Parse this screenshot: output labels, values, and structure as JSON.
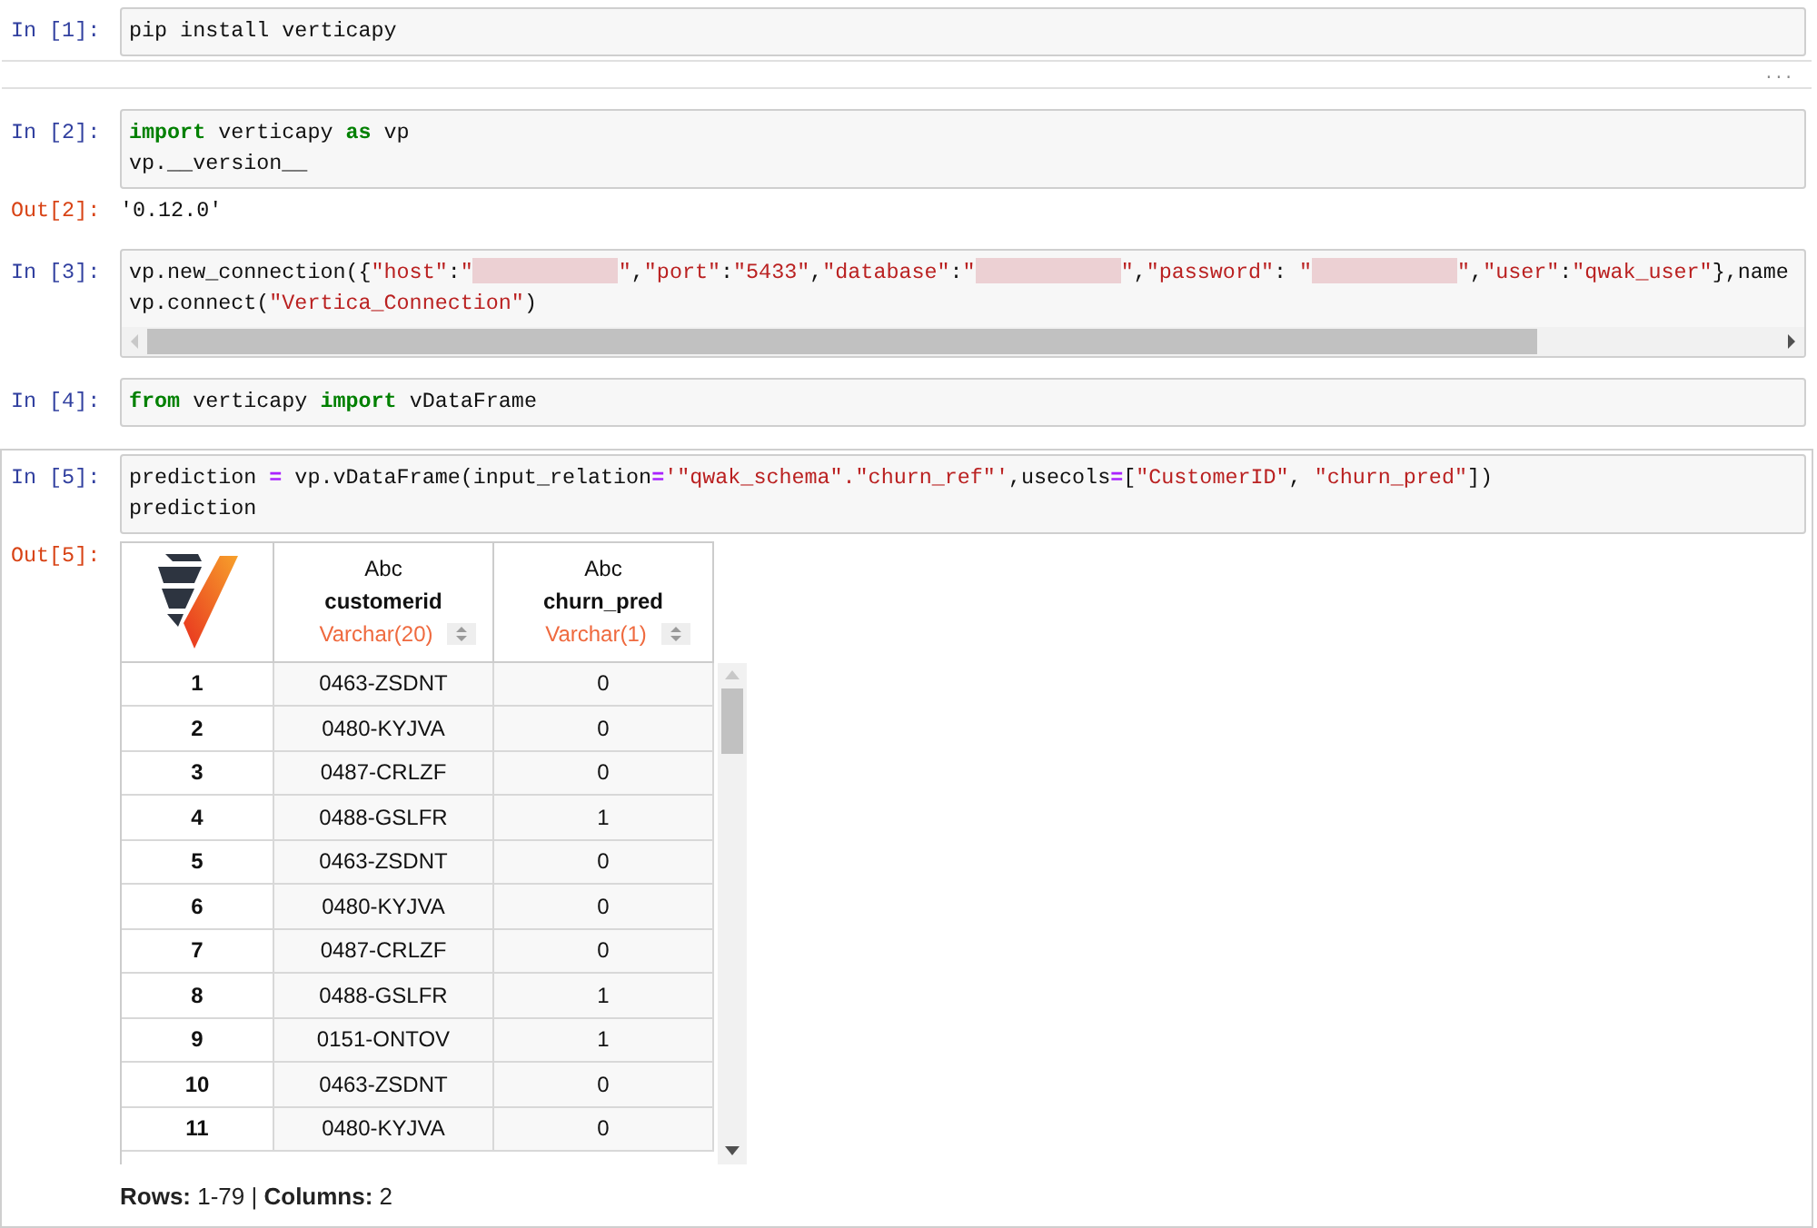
{
  "cells": [
    {
      "prompt": "In [1]:",
      "selected": false,
      "scrollbar": false,
      "lines": [
        [
          {
            "kind": "plain",
            "text": "pip install verticapy"
          }
        ]
      ],
      "collapsed_output": "..."
    },
    {
      "prompt": "In [2]:",
      "selected": false,
      "scrollbar": false,
      "lines": [
        [
          {
            "kind": "keyword",
            "text": "import"
          },
          {
            "kind": "plain",
            "text": " verticapy "
          },
          {
            "kind": "keyword",
            "text": "as"
          },
          {
            "kind": "plain",
            "text": " vp"
          }
        ],
        [
          {
            "kind": "plain",
            "text": "vp.__version__"
          }
        ]
      ],
      "output": {
        "kind": "text",
        "prompt": "Out[2]:",
        "text": "'0.12.0'"
      }
    },
    {
      "prompt": "In [3]:",
      "selected": false,
      "scrollbar": true,
      "lines": [
        [
          {
            "kind": "plain",
            "text": "vp.new_connection({"
          },
          {
            "kind": "string",
            "text": "\"host\""
          },
          {
            "kind": "plain",
            "text": ":"
          },
          {
            "kind": "string",
            "text": "\""
          },
          {
            "kind": "redacted"
          },
          {
            "kind": "string",
            "text": "\""
          },
          {
            "kind": "plain",
            "text": ","
          },
          {
            "kind": "string",
            "text": "\"port\""
          },
          {
            "kind": "plain",
            "text": ":"
          },
          {
            "kind": "string",
            "text": "\"5433\""
          },
          {
            "kind": "plain",
            "text": ","
          },
          {
            "kind": "string",
            "text": "\"database\""
          },
          {
            "kind": "plain",
            "text": ":"
          },
          {
            "kind": "string",
            "text": "\""
          },
          {
            "kind": "redacted"
          },
          {
            "kind": "string",
            "text": "\""
          },
          {
            "kind": "plain",
            "text": ","
          },
          {
            "kind": "string",
            "text": "\"password\""
          },
          {
            "kind": "plain",
            "text": ": "
          },
          {
            "kind": "string",
            "text": "\""
          },
          {
            "kind": "redacted"
          },
          {
            "kind": "string",
            "text": "\""
          },
          {
            "kind": "plain",
            "text": ","
          },
          {
            "kind": "string",
            "text": "\"user\""
          },
          {
            "kind": "plain",
            "text": ":"
          },
          {
            "kind": "string",
            "text": "\"qwak_user\""
          },
          {
            "kind": "plain",
            "text": "},name"
          }
        ],
        [
          {
            "kind": "plain",
            "text": "vp.connect("
          },
          {
            "kind": "string",
            "text": "\"Vertica_Connection\""
          },
          {
            "kind": "plain",
            "text": ")"
          }
        ]
      ]
    },
    {
      "prompt": "In [4]:",
      "selected": false,
      "scrollbar": false,
      "lines": [
        [
          {
            "kind": "keyword",
            "text": "from"
          },
          {
            "kind": "plain",
            "text": " verticapy "
          },
          {
            "kind": "keyword",
            "text": "import"
          },
          {
            "kind": "plain",
            "text": " vDataFrame"
          }
        ]
      ]
    },
    {
      "prompt": "In [5]:",
      "selected": true,
      "scrollbar": false,
      "lines": [
        [
          {
            "kind": "plain",
            "text": "prediction "
          },
          {
            "kind": "operator",
            "text": "="
          },
          {
            "kind": "plain",
            "text": " vp.vDataFrame(input_relation"
          },
          {
            "kind": "operator",
            "text": "="
          },
          {
            "kind": "string",
            "text": "'\"qwak_schema\".\"churn_ref\"'"
          },
          {
            "kind": "plain",
            "text": ",usecols"
          },
          {
            "kind": "operator",
            "text": "="
          },
          {
            "kind": "plain",
            "text": "["
          },
          {
            "kind": "string",
            "text": "\"CustomerID\""
          },
          {
            "kind": "plain",
            "text": ", "
          },
          {
            "kind": "string",
            "text": "\"churn_pred\""
          },
          {
            "kind": "plain",
            "text": "])"
          }
        ],
        [
          {
            "kind": "plain",
            "text": "prediction"
          }
        ]
      ],
      "output": {
        "kind": "table",
        "prompt": "Out[5]:",
        "columns": [
          {
            "type": "Abc",
            "name": "customerid",
            "dtype": "Varchar(20)"
          },
          {
            "type": "Abc",
            "name": "churn_pred",
            "dtype": "Varchar(1)"
          }
        ],
        "rows": [
          {
            "index": "1",
            "values": [
              "0463-ZSDNT",
              "0"
            ]
          },
          {
            "index": "2",
            "values": [
              "0480-KYJVA",
              "0"
            ]
          },
          {
            "index": "3",
            "values": [
              "0487-CRLZF",
              "0"
            ]
          },
          {
            "index": "4",
            "values": [
              "0488-GSLFR",
              "1"
            ]
          },
          {
            "index": "5",
            "values": [
              "0463-ZSDNT",
              "0"
            ]
          },
          {
            "index": "6",
            "values": [
              "0480-KYJVA",
              "0"
            ]
          },
          {
            "index": "7",
            "values": [
              "0487-CRLZF",
              "0"
            ]
          },
          {
            "index": "8",
            "values": [
              "0488-GSLFR",
              "1"
            ]
          },
          {
            "index": "9",
            "values": [
              "0151-ONTOV",
              "1"
            ]
          },
          {
            "index": "10",
            "values": [
              "0463-ZSDNT",
              "0"
            ]
          },
          {
            "index": "11",
            "values": [
              "0480-KYJVA",
              "0"
            ]
          }
        ],
        "footer": "**Rows:** 1-79 | **Columns:** 2"
      }
    }
  ]
}
